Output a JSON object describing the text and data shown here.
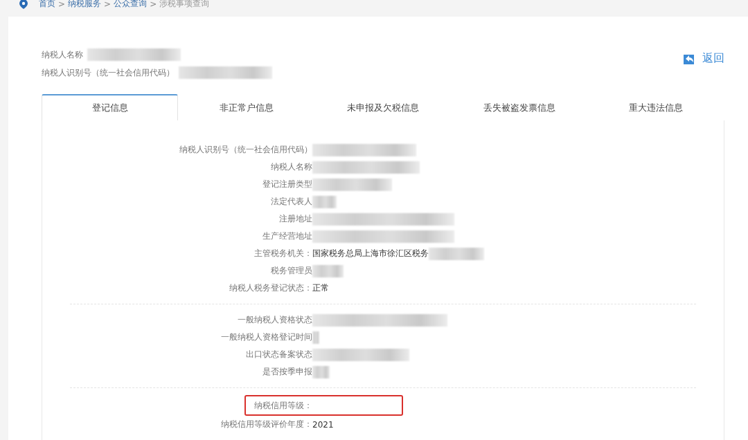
{
  "breadcrumb": [
    {
      "label": "首页",
      "current": false
    },
    {
      "label": "纳税服务",
      "current": false
    },
    {
      "label": "公众查询",
      "current": false
    },
    {
      "label": "涉税事项查询",
      "current": true
    }
  ],
  "breadcrumb_separator": ">",
  "header": {
    "fields": [
      {
        "label": "纳税人名称",
        "redacted": true
      },
      {
        "label": "纳税人识别号（统一社会信用代码）",
        "redacted": true
      }
    ],
    "back_button": "返回"
  },
  "tabs": [
    {
      "label": "登记信息",
      "selected": true
    },
    {
      "label": "非正常户信息",
      "selected": false
    },
    {
      "label": "未申报及欠税信息",
      "selected": false
    },
    {
      "label": "丢失被盗发票信息",
      "selected": false
    },
    {
      "label": "重大违法信息",
      "selected": false
    }
  ],
  "groups": [
    {
      "rows": [
        {
          "label": "纳税人识别号（统一社会信用代码）",
          "redacted": true,
          "highlighted": false
        },
        {
          "label": "纳税人名称",
          "redacted": true,
          "highlighted": false
        },
        {
          "label": "登记注册类型",
          "redacted": true,
          "highlighted": false
        },
        {
          "label": "法定代表人",
          "redacted": true,
          "highlighted": false
        },
        {
          "label": "注册地址",
          "redacted": true,
          "highlighted": false
        },
        {
          "label": "生产经营地址",
          "redacted": true,
          "highlighted": false
        },
        {
          "label": "主管税务机关：",
          "value": "国家税务总局上海市徐汇区税务",
          "redacted": true,
          "highlighted": false
        },
        {
          "label": "税务管理员",
          "redacted": true,
          "highlighted": false
        },
        {
          "label": "纳税人税务登记状态：",
          "value": "正常",
          "redacted": false,
          "highlighted": false
        }
      ]
    },
    {
      "rows": [
        {
          "label": "一般纳税人资格状态",
          "redacted": true,
          "highlighted": false
        },
        {
          "label": "一般纳税人资格登记时间",
          "redacted": true,
          "highlighted": false
        },
        {
          "label": "出口状态备案状态",
          "redacted": true,
          "highlighted": false
        },
        {
          "label": "是否按季申报",
          "redacted": true,
          "highlighted": false
        }
      ]
    },
    {
      "rows": [
        {
          "label": "纳税信用等级：",
          "redacted": false,
          "highlighted": true
        },
        {
          "label": "纳税信用等级评价年度：",
          "value": "2021",
          "redacted": false,
          "highlighted": false
        }
      ]
    }
  ]
}
